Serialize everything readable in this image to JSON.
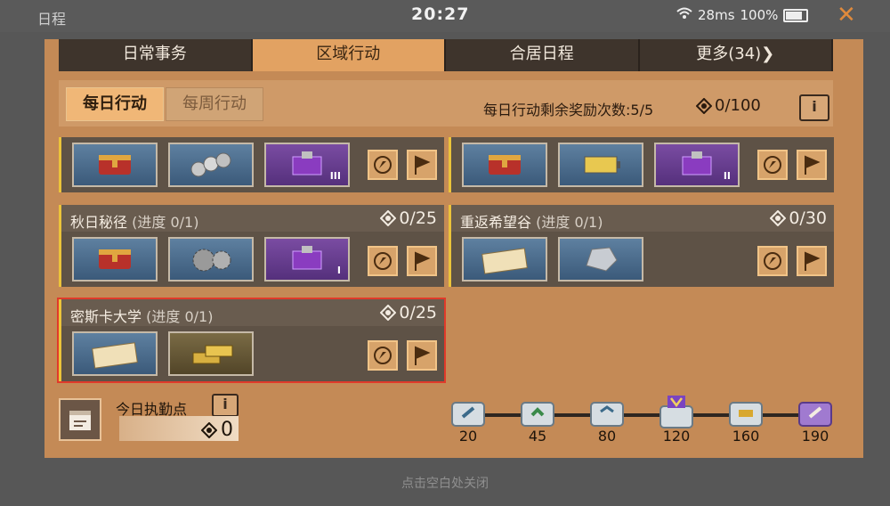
{
  "status_bar": {
    "app_title": "日程",
    "clock": "20:27",
    "network": "28ms",
    "battery": "100%"
  },
  "tabs": [
    {
      "label": "日常事务"
    },
    {
      "label": "区域行动"
    },
    {
      "label": "合居日程"
    },
    {
      "label": "更多(34)"
    }
  ],
  "subtabs": {
    "daily": "每日行动",
    "weekly": "每周行动"
  },
  "remaining": {
    "label": "每日行动剩余奖励次数:5/5",
    "points": "0/100",
    "info": "i"
  },
  "cards": [
    {
      "title": "",
      "progress": "",
      "points": "",
      "items": [
        "treasure-chest",
        "bearings",
        "purple-crate"
      ],
      "tier": "III"
    },
    {
      "title": "",
      "progress": "",
      "points": "",
      "items": [
        "treasure-chest",
        "battery",
        "purple-crate"
      ],
      "tier": "II"
    },
    {
      "title": "秋日秘径",
      "progress": "(进度 0/1)",
      "points": "0/25",
      "items": [
        "treasure-chest",
        "gears",
        "purple-crate"
      ],
      "tier": "I"
    },
    {
      "title": "重返希望谷",
      "progress": "(进度 0/1)",
      "points": "0/30",
      "items": [
        "letter",
        "ore"
      ],
      "tier": ""
    },
    {
      "title": "密斯卡大学",
      "progress": "(进度 0/1)",
      "points": "0/25",
      "items": [
        "letter",
        "gold-bars"
      ],
      "tier": ""
    }
  ],
  "duty": {
    "label": "今日执勤点",
    "value": "0",
    "info": "i"
  },
  "milestones": [
    "20",
    "45",
    "80",
    "120",
    "160",
    "190"
  ],
  "hint": "点击空白处关闭",
  "colors": {
    "accent": "#e2a262",
    "highlight_border": "#e03a2a",
    "card_bar": "#ebc33a"
  }
}
